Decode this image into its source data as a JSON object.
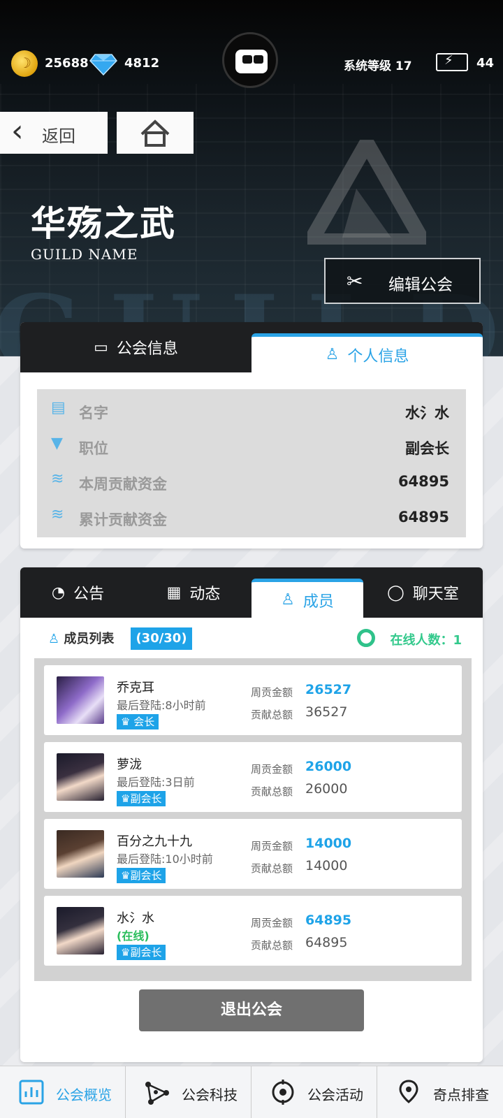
{
  "topbar": {
    "gold": "25688",
    "gems": "4812",
    "system_level": "系统等级 17",
    "energy": "44"
  },
  "nav": {
    "back_label": "返回"
  },
  "guild": {
    "name": "华殇之武",
    "name_en": "GUILD NAME",
    "watermark": "GUILD",
    "edit_label": "编辑公会"
  },
  "info_panel": {
    "tabs": [
      {
        "label": "公会信息",
        "icon": "id-card-icon",
        "active": false
      },
      {
        "label": "个人信息",
        "icon": "user-icon",
        "active": true
      }
    ],
    "rows": [
      {
        "label": "名字",
        "value": "水氵水",
        "icon": "id-card-icon"
      },
      {
        "label": "职位",
        "value": "副会长",
        "icon": "tie-icon"
      },
      {
        "label": "本周贡献资金",
        "value": "64895",
        "icon": "coins-icon"
      },
      {
        "label": "累计贡献资金",
        "value": "64895",
        "icon": "coins-icon"
      }
    ]
  },
  "member_panel": {
    "tabs": [
      {
        "label": "公告",
        "icon": "bell-icon",
        "active": false
      },
      {
        "label": "动态",
        "icon": "notes-icon",
        "active": false
      },
      {
        "label": "成员",
        "icon": "user-icon",
        "active": true
      },
      {
        "label": "聊天室",
        "icon": "chat-icon",
        "active": false
      }
    ],
    "list_title": "成员列表",
    "count": "(30/30)",
    "online_count": "在线人数：1",
    "weekly_label": "周贡金额",
    "total_label": "贡献总额",
    "members": [
      {
        "name": "乔克耳",
        "status": "最后登陆:8小时前",
        "online": false,
        "rank": "会长",
        "weekly": "26527",
        "total": "36527"
      },
      {
        "name": "萝泷",
        "status": "最后登陆:3日前",
        "online": false,
        "rank": "副会长",
        "weekly": "26000",
        "total": "26000"
      },
      {
        "name": "百分之九十九",
        "status": "最后登陆:10小时前",
        "online": false,
        "rank": "副会长",
        "weekly": "14000",
        "total": "14000"
      },
      {
        "name": "水氵水",
        "status": "(在线)",
        "online": true,
        "rank": "副会长",
        "weekly": "64895",
        "total": "64895"
      }
    ],
    "quit_label": "退出公会"
  },
  "bottom_nav": [
    {
      "label": "公会概览",
      "icon": "chart-icon",
      "active": true
    },
    {
      "label": "公会科技",
      "icon": "network-icon",
      "active": false
    },
    {
      "label": "公会活动",
      "icon": "target-icon",
      "active": false
    },
    {
      "label": "奇点排查",
      "icon": "map-pin-icon",
      "active": false
    }
  ],
  "colors": {
    "accent": "#2aa3e6",
    "online": "#2bbd5c",
    "dark_tab": "#1e1f21"
  }
}
